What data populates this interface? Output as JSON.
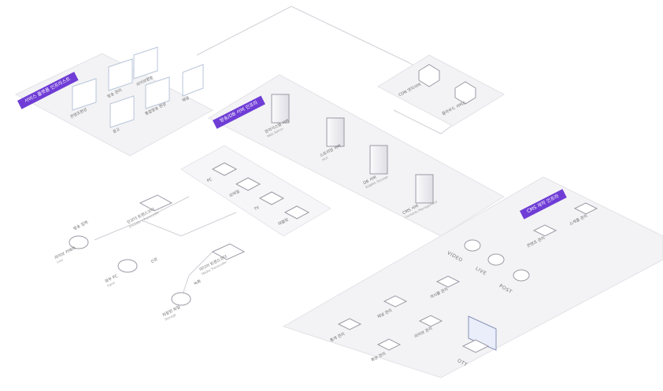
{
  "zones": {
    "top_left": "서비스 플랫폼 인프라스트",
    "server": "방송/DB 서버 인프라",
    "cms": "CMS 제작 인프라"
  },
  "top_left_items": [
    "라이브방송",
    "채널",
    "방송 관리",
    "통합방송 편성",
    "콘텐츠편성",
    "광고"
  ],
  "servers": [
    {
      "label": "관리시스템 서버",
      "sub": "Web Admin"
    },
    {
      "label": "스트리밍 서버",
      "sub": "HLS"
    },
    {
      "label": "DB 서버",
      "sub": "RDBMS Storage"
    },
    {
      "label": "CMS 서버",
      "sub": "Contents Management"
    }
  ],
  "cloud": [
    "CDN 엣지서버",
    "클라우드 서비스"
  ],
  "devices": [
    "PC",
    "모바일",
    "TV",
    "태블릿"
  ],
  "encoder": {
    "label": "인코더 트랜스코더",
    "sub": "Encoder / Transcoder"
  },
  "encoder2": {
    "label": "미디어 트랜스코더",
    "sub": "Media Transcoder"
  },
  "sources": [
    {
      "label": "라이브 카메라",
      "sub": "Live"
    },
    {
      "label": "외부 PC",
      "sub": "Input"
    },
    {
      "label": "저장된 파일",
      "sub": "Storage"
    }
  ],
  "source_notes": [
    "방송 입력",
    "신호",
    "녹화"
  ],
  "cms_modules": [
    "콘텐츠 관리",
    "스케줄 관리",
    "채널 관리",
    "게시물 관리",
    "통계 관리",
    "회원 관리",
    "라이브 관리"
  ],
  "flows": [
    "VIDEO",
    "LIVE",
    "POST"
  ],
  "ott": "OTT",
  "colors": {
    "accent": "#6f3dd6",
    "platform": "#f3f3f5",
    "line": "#c9c9cf"
  }
}
